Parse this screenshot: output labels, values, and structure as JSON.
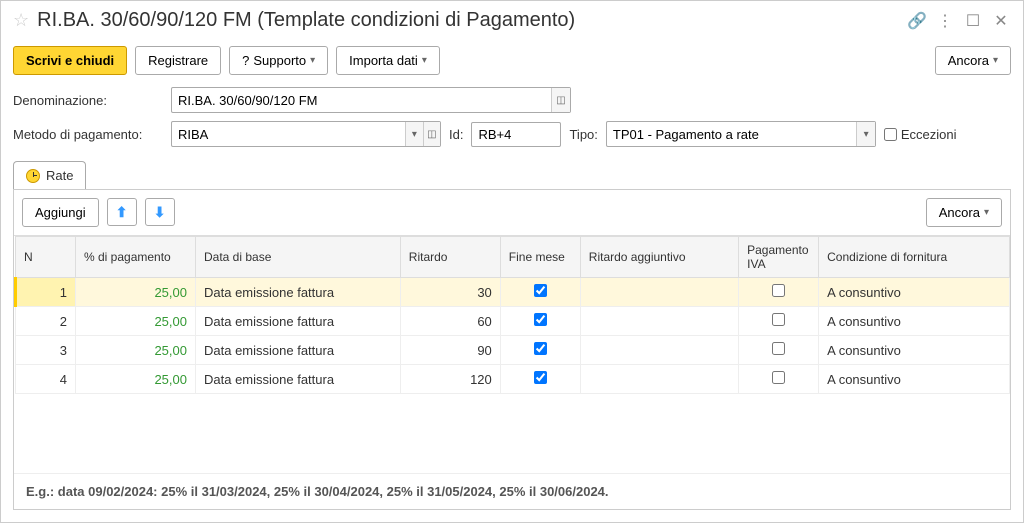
{
  "title": "RI.BA. 30/60/90/120 FM (Template condizioni di Pagamento)",
  "toolbar": {
    "save_close": "Scrivi e chiudi",
    "register": "Registrare",
    "support": "Supporto",
    "support_q": "?",
    "import": "Importa dati",
    "more": "Ancora"
  },
  "form": {
    "denom_label": "Denominazione:",
    "denom_value": "RI.BA. 30/60/90/120 FM",
    "method_label": "Metodo di pagamento:",
    "method_value": "RIBA",
    "id_label": "Id:",
    "id_value": "RB+4",
    "type_label": "Tipo:",
    "type_value": "TP01 - Pagamento a rate",
    "exceptions_label": "Eccezioni"
  },
  "tab": {
    "rate": "Rate"
  },
  "tab_toolbar": {
    "add": "Aggiungi",
    "more": "Ancora"
  },
  "columns": {
    "n": "N",
    "pct": "% di pagamento",
    "base": "Data di base",
    "delay": "Ritardo",
    "eom": "Fine mese",
    "extra_delay": "Ritardo aggiuntivo",
    "vat": "Pagamento IVA",
    "supply": "Condizione di fornitura"
  },
  "rows": [
    {
      "n": "1",
      "pct": "25,00",
      "base": "Data emissione fattura",
      "delay": "30",
      "eom": true,
      "vat": false,
      "supply": "A consuntivo"
    },
    {
      "n": "2",
      "pct": "25,00",
      "base": "Data emissione fattura",
      "delay": "60",
      "eom": true,
      "vat": false,
      "supply": "A consuntivo"
    },
    {
      "n": "3",
      "pct": "25,00",
      "base": "Data emissione fattura",
      "delay": "90",
      "eom": true,
      "vat": false,
      "supply": "A consuntivo"
    },
    {
      "n": "4",
      "pct": "25,00",
      "base": "Data emissione fattura",
      "delay": "120",
      "eom": true,
      "vat": false,
      "supply": "A consuntivo"
    }
  ],
  "footer": "E.g.: data 09/02/2024: 25% il 31/03/2024, 25% il 30/04/2024, 25% il 31/05/2024, 25% il 30/06/2024."
}
